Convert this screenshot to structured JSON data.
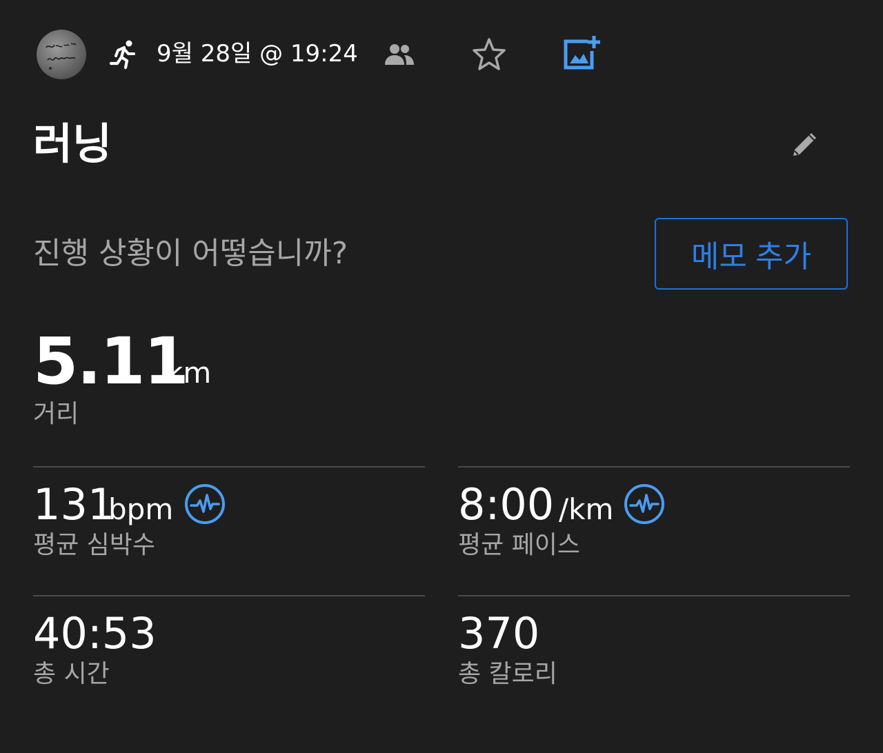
{
  "header": {
    "avatar_icon": "user-avatar",
    "activity_icon": "running-icon",
    "date_time": "9월 28일 @ 19:24",
    "people_icon": "people-icon",
    "star_icon": "star-outline-icon",
    "photo_add_icon": "add-photo-icon"
  },
  "activity": {
    "title": "러닝",
    "edit_icon": "pencil-icon"
  },
  "notes": {
    "prompt": "진행 상황이 어떻습니까?",
    "add_memo_button": "메모 추가"
  },
  "distance": {
    "value": "5.11",
    "unit": "km",
    "label": "거리"
  },
  "stats": {
    "heart_rate": {
      "value": "131",
      "unit": "bpm",
      "label": "평균 심박수",
      "icon": "pulse-chart-icon"
    },
    "pace": {
      "value": "8:00",
      "unit": "/km",
      "label": "평균 페이스",
      "icon": "pulse-chart-icon"
    },
    "total_time": {
      "value": "40:53",
      "label": "총 시간"
    },
    "calories": {
      "value": "370",
      "label": "총 칼로리"
    }
  },
  "colors": {
    "background": "#1e1e1f",
    "accent_blue": "#2f7fe6",
    "icon_blue": "#4a9df0",
    "label_gray": "#a6a6a6",
    "divider": "#4a4a4c"
  }
}
